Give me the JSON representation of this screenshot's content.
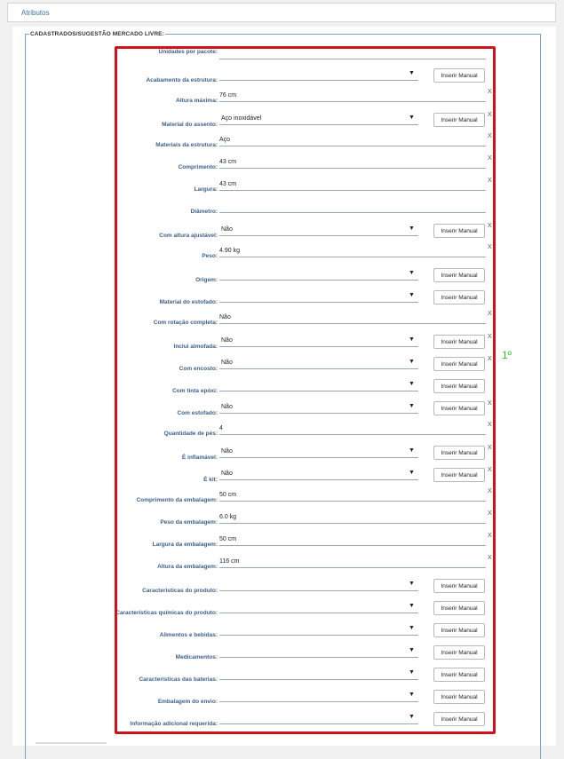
{
  "tabs": {
    "atributos": "Atributos"
  },
  "section": {
    "legend": "CADASTRADOS/SUGESTÃO MERCADO LIVRE:",
    "annotation": "1º"
  },
  "colors": {
    "highlight": "#d0121b",
    "annotation": "#2fc52f",
    "label": "#3c5f88"
  },
  "icons": {
    "dropdown": "triangle-down-icon",
    "clear": "x-icon"
  },
  "fields": [
    {
      "label": "Unidades por pacote:",
      "kind": "text",
      "value": "",
      "clear": ""
    },
    {
      "label": "Acabamento da estrutura:",
      "kind": "select",
      "value": "",
      "button": "Inserir Manual",
      "clear": ""
    },
    {
      "label": "Altura máxima:",
      "kind": "text",
      "value": "76 cm",
      "clear": "X"
    },
    {
      "label": "Material do assento:",
      "kind": "select",
      "value": "Aço inoxidável",
      "button": "Inserir Manual",
      "clear": "X"
    },
    {
      "label": "Materiais da estrutura:",
      "kind": "text",
      "value": "Aço",
      "clear": "X"
    },
    {
      "label": "Comprimento:",
      "kind": "text",
      "value": "43 cm",
      "clear": "X"
    },
    {
      "label": "Largura:",
      "kind": "text",
      "value": "43 cm",
      "clear": "X"
    },
    {
      "label": "Diâmetro:",
      "kind": "text",
      "value": "",
      "clear": ""
    },
    {
      "label": "Com altura ajustável:",
      "kind": "select",
      "value": "Não",
      "button": "Inserir Manual",
      "clear": "X"
    },
    {
      "label": "Peso:",
      "kind": "text",
      "value": "4.90 kg",
      "clear": "X"
    },
    {
      "label": "Origem:",
      "kind": "select",
      "value": "",
      "button": "Inserir Manual",
      "clear": ""
    },
    {
      "label": "Material do estofado:",
      "kind": "select",
      "value": "",
      "button": "Inserir Manual",
      "clear": ""
    },
    {
      "label": "Com rotação completa:",
      "kind": "text",
      "value": "Não",
      "clear": "X"
    },
    {
      "label": "Inclui almofada:",
      "kind": "select",
      "value": "Não",
      "button": "Inserir Manual",
      "clear": "X"
    },
    {
      "label": "Com encosto:",
      "kind": "select",
      "value": "Não",
      "button": "Inserir Manual",
      "clear": "X"
    },
    {
      "label": "Com tinta epóxi:",
      "kind": "select",
      "value": "",
      "button": "Inserir Manual",
      "clear": ""
    },
    {
      "label": "Com estofado:",
      "kind": "select",
      "value": "Não",
      "button": "Inserir Manual",
      "clear": "X"
    },
    {
      "label": "Quantidade de pés:",
      "kind": "text",
      "value": "4",
      "clear": "X"
    },
    {
      "label": "É inflamável:",
      "kind": "select",
      "value": "Não",
      "button": "Inserir Manual",
      "clear": "X"
    },
    {
      "label": "É kit:",
      "kind": "select",
      "value": "Não",
      "button": "Inserir Manual",
      "clear": "X"
    },
    {
      "label": "Comprimento da embalagem:",
      "kind": "text",
      "value": "50 cm",
      "clear": "X"
    },
    {
      "label": "Peso da embalagem:",
      "kind": "text",
      "value": "6.0 kg",
      "clear": "X"
    },
    {
      "label": "Largura da embalagem:",
      "kind": "text",
      "value": "50 cm",
      "clear": "X"
    },
    {
      "label": "Altura da embalagem:",
      "kind": "text",
      "value": "116 cm",
      "clear": "X"
    },
    {
      "label": "Características do produto:",
      "kind": "select",
      "value": "",
      "button": "Inserir Manual",
      "clear": ""
    },
    {
      "label": "Características químicas do produto:",
      "kind": "select",
      "value": "",
      "button": "Inserir Manual",
      "clear": ""
    },
    {
      "label": "Alimentos e bebidas:",
      "kind": "select",
      "value": "",
      "button": "Inserir Manual",
      "clear": ""
    },
    {
      "label": "Medicamentos:",
      "kind": "select",
      "value": "",
      "button": "Inserir Manual",
      "clear": ""
    },
    {
      "label": "Características das baterias:",
      "kind": "select",
      "value": "",
      "button": "Inserir Manual",
      "clear": ""
    },
    {
      "label": "Embalagem do envio:",
      "kind": "select",
      "value": "",
      "button": "Inserir Manual",
      "clear": ""
    },
    {
      "label": "Informação adicional requerida:",
      "kind": "select",
      "value": "",
      "button": "Inserir Manual",
      "clear": ""
    }
  ]
}
